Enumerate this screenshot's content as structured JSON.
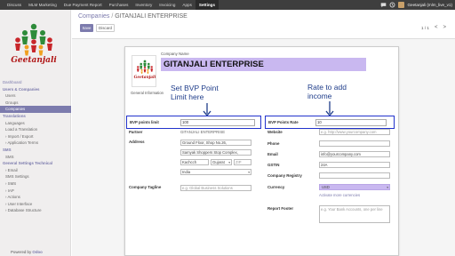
{
  "topbar": {
    "menu": [
      "Discuss",
      "MLM Marketing",
      "Due Payment Report",
      "Purchases",
      "Inventory",
      "Invoicing",
      "Apps",
      "Settings"
    ],
    "active_menu": "Settings",
    "user_name": "Geetanjali (mlm_live_v1)"
  },
  "sidebar": {
    "logo_text": "Geetanjali",
    "nav": [
      {
        "label": "Dashboard",
        "type": "head"
      },
      {
        "label": "Users & Companies",
        "type": "sub"
      },
      {
        "label": "Users",
        "type": "item"
      },
      {
        "label": "Groups",
        "type": "item"
      },
      {
        "label": "Companies",
        "type": "item",
        "active": true
      },
      {
        "label": "Translations",
        "type": "sub"
      },
      {
        "label": "Languages",
        "type": "item"
      },
      {
        "label": "Load a Translation",
        "type": "item"
      },
      {
        "label": "› Import / Export",
        "type": "item"
      },
      {
        "label": "› Application Terms",
        "type": "item"
      },
      {
        "label": "SMS",
        "type": "sub"
      },
      {
        "label": "SMS",
        "type": "item"
      },
      {
        "label": "General Settings Technical",
        "type": "sub"
      },
      {
        "label": "› Email",
        "type": "item"
      },
      {
        "label": "SMS Settings",
        "type": "item"
      },
      {
        "label": "› SMS",
        "type": "item"
      },
      {
        "label": "› IAP",
        "type": "item"
      },
      {
        "label": "› Actions",
        "type": "item"
      },
      {
        "label": "› User Interface",
        "type": "item"
      },
      {
        "label": "› Database Structure",
        "type": "item"
      }
    ],
    "powered_prefix": "Powered by ",
    "powered_brand": "Odoo"
  },
  "control": {
    "breadcrumb_parent": "Companies",
    "breadcrumb_sep": " / ",
    "breadcrumb_current": "GITANJALI ENTERPRISE",
    "save_label": "Save",
    "discard_label": "Discard",
    "pager_value": "1 / 1",
    "pager_prev": "<",
    "pager_next": ">"
  },
  "sheet": {
    "logo_text": "Geetanjali",
    "company_name_label": "Company Name",
    "company_name": "GITANJALI ENTERPRISE",
    "general_info_tab": "General Information",
    "annotation_left": "Set BVP Point\nLimit here",
    "annotation_right": "Rate to add\nincome",
    "bvp_limit_label": "BVP points limit",
    "bvp_limit_value": "100",
    "bvp_rate_label": "BVP Points Rate",
    "bvp_rate_value": "10",
    "partner_label": "Partner",
    "partner_value": "GITANJALI ENTERPRISE",
    "address_label": "Address",
    "address_line1": "Ground Floor, Shop No.26,",
    "address_line2": "Samyak Shoppers Stop Complex,",
    "address_city": "Kachcch",
    "address_state": "Gujarat",
    "address_zip_placeholder": "ZIP",
    "address_country": "India",
    "tagline_label": "Company Tagline",
    "tagline_placeholder": "e.g. Global Business Solutions",
    "website_label": "Website",
    "website_placeholder": "e.g. http://www.yourcompany.com",
    "phone_label": "Phone",
    "email_label": "Email",
    "email_value": "info@yourcompany.com",
    "gstin_label": "GSTIN",
    "gstin_value": "24A",
    "registry_label": "Company Registry",
    "currency_label": "Currency",
    "currency_value": "USD",
    "currency_link": "Activate more currencies",
    "footer_label": "Report Footer",
    "footer_placeholder": "e.g. Your Bank Accounts, one per line",
    "accent": "#7c7bad",
    "highlight": "#c9b8f0",
    "annotation_color": "#1f3d8a",
    "box_color": "#2233cc"
  }
}
